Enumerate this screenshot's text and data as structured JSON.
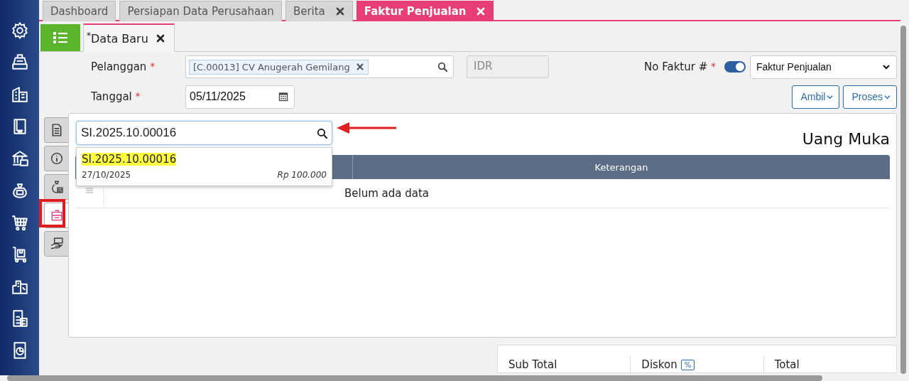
{
  "tabs": [
    {
      "label": "Dashboard",
      "selected": false,
      "closable": false
    },
    {
      "label": "Persiapan Data Perusahaan",
      "selected": false,
      "closable": false
    },
    {
      "label": "Berita",
      "selected": false,
      "closable": true
    },
    {
      "label": "Faktur Penjualan",
      "selected": true,
      "closable": true
    }
  ],
  "subtab": {
    "marker": "*",
    "label": "Data Baru"
  },
  "form": {
    "customer_label": "Pelanggan",
    "customer_tag": "[C.00013] CV Anugerah Gemilang",
    "currency": "IDR",
    "date_label": "Tanggal",
    "date": "05/11/2025",
    "number_label": "No Faktur #",
    "auto_number": true,
    "number_type": "Faktur Penjualan",
    "required_mark": "*"
  },
  "actions": [
    "Ambil",
    "Proses"
  ],
  "side_tabs": [
    {
      "selected": false
    },
    {
      "selected": false
    },
    {
      "selected": false
    },
    {
      "selected": true
    },
    {
      "selected": false
    }
  ],
  "panel": {
    "title": "Uang Muka",
    "search": {
      "value": "SI.2025.10.00016"
    },
    "results": [
      {
        "code": "SI.2025.10.00016",
        "date": "27/10/2025",
        "amount": "Rp 100.000"
      }
    ],
    "columns": [
      "Keterangan"
    ],
    "empty": "Belum ada data"
  },
  "summary": {
    "subtotal": "Sub Total",
    "discount": "Diskon",
    "discount_unit": "%",
    "total": "Total"
  }
}
